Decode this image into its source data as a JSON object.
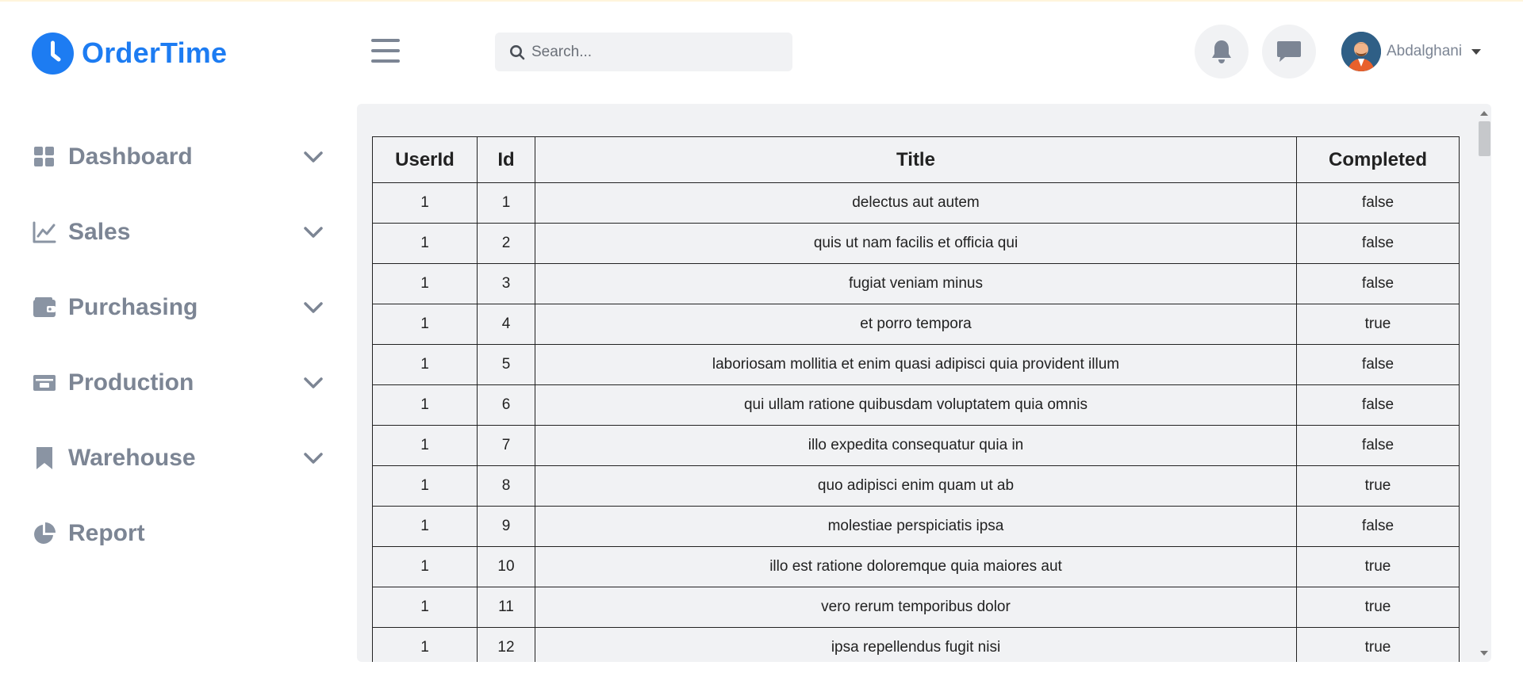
{
  "brand": {
    "name": "OrderTime",
    "icon": "clock-icon",
    "color": "#1d7cf2"
  },
  "sidebar": {
    "items": [
      {
        "label": "Dashboard",
        "icon": "grid-icon",
        "expandable": true
      },
      {
        "label": "Sales",
        "icon": "line-chart-icon",
        "expandable": true
      },
      {
        "label": "Purchasing",
        "icon": "wallet-icon",
        "expandable": true
      },
      {
        "label": "Production",
        "icon": "money-icon",
        "expandable": true
      },
      {
        "label": "Warehouse",
        "icon": "bookmark-icon",
        "expandable": true
      },
      {
        "label": "Report",
        "icon": "pie-chart-icon",
        "expandable": false
      }
    ]
  },
  "header": {
    "menu_icon": "hamburger-icon",
    "search": {
      "placeholder": "Search...",
      "value": ""
    },
    "notifications_icon": "bell-icon",
    "messages_icon": "chat-icon",
    "user": {
      "name": "Abdalghani",
      "avatar_icon": "avatar-icon"
    }
  },
  "table": {
    "columns": [
      "UserId",
      "Id",
      "Title",
      "Completed"
    ],
    "rows": [
      [
        "1",
        "1",
        "delectus aut autem",
        "false"
      ],
      [
        "1",
        "2",
        "quis ut nam facilis et officia qui",
        "false"
      ],
      [
        "1",
        "3",
        "fugiat veniam minus",
        "false"
      ],
      [
        "1",
        "4",
        "et porro tempora",
        "true"
      ],
      [
        "1",
        "5",
        "laboriosam mollitia et enim quasi adipisci quia provident illum",
        "false"
      ],
      [
        "1",
        "6",
        "qui ullam ratione quibusdam voluptatem quia omnis",
        "false"
      ],
      [
        "1",
        "7",
        "illo expedita consequatur quia in",
        "false"
      ],
      [
        "1",
        "8",
        "quo adipisci enim quam ut ab",
        "true"
      ],
      [
        "1",
        "9",
        "molestiae perspiciatis ipsa",
        "false"
      ],
      [
        "1",
        "10",
        "illo est ratione doloremque quia maiores aut",
        "true"
      ],
      [
        "1",
        "11",
        "vero rerum temporibus dolor",
        "true"
      ],
      [
        "1",
        "12",
        "ipsa repellendus fugit nisi",
        "true"
      ]
    ]
  }
}
